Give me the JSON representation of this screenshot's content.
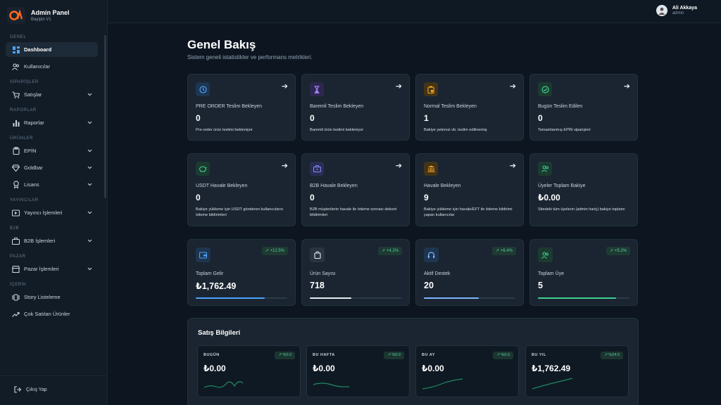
{
  "brand": {
    "title": "Admin Panel",
    "subtitle": "Bayipin V1"
  },
  "user": {
    "name": "Ali Akkaya",
    "role": "admin"
  },
  "nav": {
    "sections": [
      "GENEL",
      "SİPARİŞLER",
      "RAPORLAR",
      "ÜRÜNLER",
      "YAYINCILAR",
      "B2B",
      "PAZAR",
      "İÇERİK"
    ],
    "items": [
      {
        "label": "Dashboard",
        "icon": "dashboard-icon"
      },
      {
        "label": "Kullanıcılar",
        "icon": "users-icon"
      },
      {
        "label": "Satışlar",
        "icon": "cart-icon"
      },
      {
        "label": "Raporlar",
        "icon": "bar-chart-icon"
      },
      {
        "label": "EPİN",
        "icon": "clipboard-icon"
      },
      {
        "label": "Goldbar",
        "icon": "diamond-icon"
      },
      {
        "label": "Lisans",
        "icon": "license-icon"
      },
      {
        "label": "Yayıncı İşlemleri",
        "icon": "video-icon"
      },
      {
        "label": "B2B İşlemleri",
        "icon": "briefcase-icon"
      },
      {
        "label": "Pazar İşlemleri",
        "icon": "store-icon"
      },
      {
        "label": "Story Listeleme",
        "icon": "story-icon"
      },
      {
        "label": "Çok Satılan Ürünler",
        "icon": "trending-icon"
      }
    ],
    "logout": "Çıkış Yap"
  },
  "page": {
    "title": "Genel Bakış",
    "subtitle": "Sistem geneli istatistikler ve performans metrikleri."
  },
  "status_cards": [
    {
      "title": "PRE ORDER Teslim Bekleyen",
      "value": "0",
      "desc": "Pre-order ürün teslimi bekleniyor",
      "icon": "clock-icon",
      "color": "#4da3ff"
    },
    {
      "title": "Baremli Teslim Bekleyen",
      "value": "0",
      "desc": "Baremli ürün teslimi bekleniyor",
      "icon": "hourglass-icon",
      "color": "#a78bfa"
    },
    {
      "title": "Normal Teslim Bekleyen",
      "value": "1",
      "desc": "Bakiye yetersiz vb. teslim edilmemiş",
      "icon": "pending-icon",
      "color": "#f5a524"
    },
    {
      "title": "Bugün Teslim Edilen",
      "value": "0",
      "desc": "Tamamlanmış EPİN siparişleri",
      "icon": "check-circle-icon",
      "color": "#3ecf8e"
    },
    {
      "title": "USDT Havale Bekleyen",
      "value": "0",
      "desc": "Bakiye yükleme için USDT gönderen kullanıcıların ödeme bildirimleri",
      "icon": "piggy-bank-icon",
      "color": "#3ecf8e"
    },
    {
      "title": "B2B Havale Bekleyen",
      "value": "0",
      "desc": "B2B müşterilerin havale ile ödeme sonrası dekont bildirimleri",
      "icon": "briefcase-icon",
      "color": "#818cf8"
    },
    {
      "title": "Havale Bekleyen",
      "value": "9",
      "desc": "Bakiye yükleme için havale/EFT ile ödeme bildirimi yapan kullanıcılar",
      "icon": "bank-icon",
      "color": "#f5a524"
    },
    {
      "title": "Üyeler Toplam Bakiye",
      "value": "₺0.00",
      "desc": "Sitedeki tüm üyelerin (admin hariç) bakiye toplamı",
      "icon": "users-icon",
      "color": "#3ecf8e"
    }
  ],
  "stat_cards": [
    {
      "title": "Toplam Gelir",
      "value": "₺1,762.49",
      "badge": "↗ +12.5%",
      "progress": 0.75,
      "icon": "wallet-icon",
      "color": "#4da3ff"
    },
    {
      "title": "Ürün Sayısı",
      "value": "718",
      "badge": "↗ +4.2%",
      "progress": 0.45,
      "icon": "bag-icon",
      "color": "#e6edf3"
    },
    {
      "title": "Aktif Destek",
      "value": "20",
      "badge": "↗ +6.4%",
      "progress": 0.6,
      "icon": "headset-icon",
      "color": "#7fb3ff"
    },
    {
      "title": "Toplam Üye",
      "value": "5",
      "badge": "↗ +5.2%",
      "progress": 0.85,
      "icon": "users-icon",
      "color": "#3ecf8e"
    }
  ],
  "sales": {
    "title": "Satış Bilgileri",
    "cards": [
      {
        "label": "BUGÜN",
        "value": "₺0.00",
        "badge": "↗ %0.0"
      },
      {
        "label": "BU HAFTA",
        "value": "₺0.00",
        "badge": "↗ %0.0"
      },
      {
        "label": "BU AY",
        "value": "₺0.00",
        "badge": "↗ %0.0"
      },
      {
        "label": "BU YIL",
        "value": "₺1,762.49",
        "badge": "↗ %24.5"
      }
    ]
  },
  "colors": {
    "accent_green": "#3ecf8e",
    "bg": "#0d1620",
    "card": "#1a2531"
  }
}
